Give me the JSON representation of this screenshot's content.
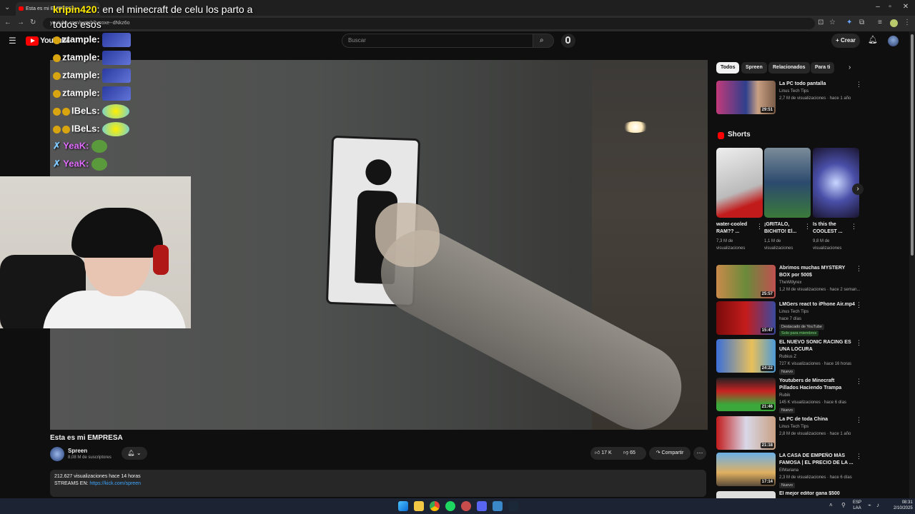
{
  "browser": {
    "tab_title": "Esta es mi EMPRESA",
    "url": "youtube.com/watch?v=oxe--dNkz6o"
  },
  "youtube": {
    "logo_text": "YouTube",
    "search_placeholder": "Buscar",
    "create_label": "Crear"
  },
  "chat": {
    "top_user": "kripin420",
    "top_message": ": en el minecraft de celu los parto a todos esos",
    "lines": [
      {
        "user": "ztample:"
      },
      {
        "user": "ztample:"
      },
      {
        "user": "ztample:"
      },
      {
        "user": "ztample:"
      },
      {
        "user": "IBeLs:"
      },
      {
        "user": "IBeLs:"
      },
      {
        "user": "YeaK:"
      },
      {
        "user": "YeaK:"
      }
    ]
  },
  "video": {
    "title": "Esta es mi EMPRESA",
    "channel": "Spreen",
    "subscribers": "8,08 M de suscriptores",
    "likes": "17 K",
    "dislikes": "65",
    "share_label": "Compartir",
    "views_line": "212.627 visualizaciones  hace 14 horas",
    "streams_label": "STREAMS EN: ",
    "streams_link": "https://kick.com/spreen"
  },
  "sidebar": {
    "chips": [
      "Todos",
      "Spreen",
      "Relacionados",
      "Para ti"
    ],
    "shorts_label": "Shorts",
    "top_rec": {
      "title": "La PC todo pantalla",
      "channel": "Linus Tech Tips",
      "meta": "2,7 M de visualizaciones · hace 1 año",
      "duration": "29:51"
    },
    "shorts": [
      {
        "title": "water-cooled RAM?? ...",
        "meta": "7,3 M de visualizaciones"
      },
      {
        "title": "¡GRITALO, BICHITO! El...",
        "meta": "1,1 M de visualizaciones"
      },
      {
        "title": "Is this the COOLEST ...",
        "meta": "9,8 M de visualizaciones"
      }
    ],
    "recs": [
      {
        "title": "Abrimos muchas MYSTERY BOX por 500$",
        "channel": "TheWillyrex",
        "meta": "1,2 M de visualizaciones · hace 2 seman...",
        "duration": "25:57"
      },
      {
        "title": "LMGers react to iPhone Air.mp4",
        "channel": "Linus Tech Tips",
        "meta": "hace 7 días",
        "duration": "15:47",
        "tag": "Destacado de YouTube",
        "tag2": "Solo para miembros"
      },
      {
        "title": "EL NUEVO SONIC RACING ES UNA LOCURA",
        "channel": "Rubius Z",
        "meta": "727 K visualizaciones · hace 16 horas",
        "duration": "24:22",
        "tag": "Nuevo"
      },
      {
        "title": "Youtubers de Minecraft Pillados Haciendo Trampa",
        "channel": "Rubik",
        "meta": "145 K visualizaciones · hace 6 días",
        "duration": "21:46",
        "tag": "Nuevo"
      },
      {
        "title": "La PC de toda China",
        "channel": "Linus Tech Tips",
        "meta": "2,8 M de visualizaciones · hace 1 año",
        "duration": "21:18"
      },
      {
        "title": "LA CASA DE EMPEÑO MÁS FAMOSA | EL PRECIO DE LA ...",
        "channel": "ElMariana",
        "meta": "2,3 M de visualizaciones · hace 6 días",
        "duration": "17:14",
        "tag": "Nuevo"
      },
      {
        "title": "El mejor editor gana $500",
        "channel": "",
        "meta": "",
        "duration": ""
      }
    ]
  },
  "taskbar": {
    "lang_line1": "ESP",
    "lang_line2": "LAA",
    "time": "08:31",
    "date": "2/10/2025"
  },
  "colors": {
    "brand_red": "#ff0000",
    "link_blue": "#3ea6ff",
    "chat_user_yellow": "#ffea00"
  }
}
